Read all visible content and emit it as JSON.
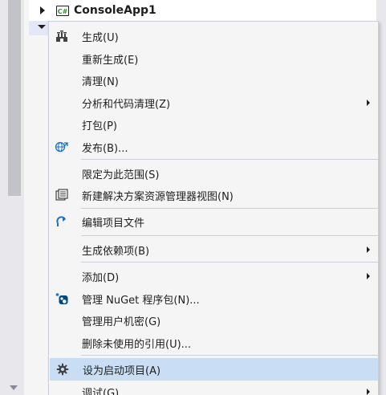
{
  "solution_explorer": {
    "project_icon_text": "C#",
    "project_name": "ConsoleApp1"
  },
  "context_menu": {
    "items": [
      {
        "label": "生成(U)",
        "icon": "build-icon"
      },
      {
        "label": "重新生成(E)"
      },
      {
        "label": "清理(N)"
      },
      {
        "label": "分析和代码清理(Z)",
        "submenu": true
      },
      {
        "label": "打包(P)"
      },
      {
        "label": "发布(B)...",
        "icon": "publish-globe-icon"
      },
      {
        "label": "限定为此范围(S)"
      },
      {
        "label": "新建解决方案资源管理器视图(N)",
        "icon": "new-explorer-view-icon"
      },
      {
        "label": "编辑项目文件",
        "icon": "edit-project-file-icon"
      },
      {
        "label": "生成依赖项(B)",
        "submenu": true
      },
      {
        "label": "添加(D)",
        "submenu": true
      },
      {
        "label": "管理 NuGet 程序包(N)...",
        "icon": "nuget-icon"
      },
      {
        "label": "管理用户机密(G)"
      },
      {
        "label": "删除未使用的引用(U)..."
      },
      {
        "label": "设为启动项目(A)",
        "icon": "gear-icon",
        "highlighted": true
      },
      {
        "label": "调试(G)",
        "submenu": true
      }
    ]
  },
  "colors": {
    "menu_background": "#f5f5f5",
    "menu_border": "#cccedb",
    "highlight": "#c9def5",
    "accent_blue": "#1e6fc6"
  }
}
